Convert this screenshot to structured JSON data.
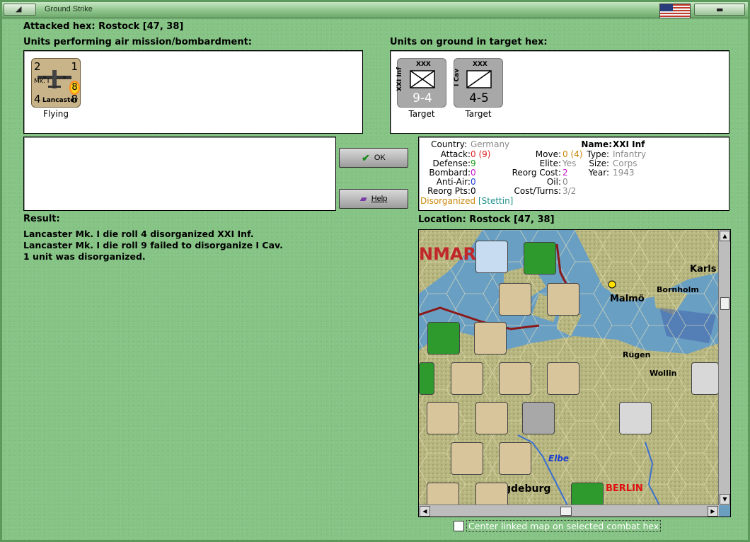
{
  "window": {
    "title": "Ground Strike"
  },
  "attacked_hex": {
    "label": "Attacked hex:",
    "value": "Rostock  [47, 38]"
  },
  "air_units": {
    "heading": "Units performing air mission/bombardment:",
    "items": [
      {
        "name": "Lancaster",
        "variant": "Mk. I",
        "top_left": "2",
        "top_right": "1",
        "bottom_left": "4",
        "bottom_right": "8",
        "badge": "8",
        "status": "Flying"
      }
    ]
  },
  "ground_units": {
    "heading": "Units on ground in target hex:",
    "items": [
      {
        "name": "XXI Inf",
        "size": "XXX",
        "strength": "9-4",
        "status": "Target"
      },
      {
        "name": "I Cav",
        "size": "XXX",
        "strength": "4-5",
        "status": "Target"
      }
    ]
  },
  "buttons": {
    "ok": "OK",
    "help": "Help"
  },
  "unit_info": {
    "country_label": "Country:",
    "country": "Germany",
    "attack_label": "Attack:",
    "attack": "0",
    "attack_mod": "(9)",
    "defense_label": "Defense:",
    "defense": "9",
    "bombard_label": "Bombard:",
    "bombard": "0",
    "antiair_label": "Anti-Air:",
    "antiair": "0",
    "reorg_label": "Reorg Pts:",
    "reorg": "0",
    "move_label": "Move:",
    "move": "0",
    "move_mod": "(4)",
    "elite_label": "Elite:",
    "elite": "Yes",
    "reorg_cost_label": "Reorg Cost:",
    "reorg_cost": "2",
    "oil_label": "Oil:",
    "oil": "0",
    "cost_turns_label": "Cost/Turns:",
    "cost_turns": "3/2",
    "name_label": "Name:",
    "name": "XXI Inf",
    "type_label": "Type:",
    "type": "Infantry",
    "size_label": "Size:",
    "size": "Corps",
    "year_label": "Year:",
    "year": "1943",
    "status": "Disorganized",
    "location": "[Stettin]"
  },
  "result": {
    "heading": "Result:",
    "lines": [
      "Lancaster Mk. I die roll 4 disorganized XXI Inf.",
      "Lancaster Mk. I die roll 9 failed to disorganize I Cav.",
      "1 unit was disorganized."
    ]
  },
  "location": {
    "label": "Location:",
    "value": "Rostock  [47, 38]"
  },
  "map": {
    "labels": [
      "NMAR",
      "Karls",
      "Malmö",
      "Bornholm",
      "Rügen",
      "Wollin",
      "Elbe",
      "BERLIN",
      "gdeburg"
    ]
  },
  "center_checkbox": {
    "label": "Center linked map on selected combat hex",
    "checked": false
  },
  "colors": {
    "window_bg": "#86c485",
    "panel_bg": "#ffffff",
    "target_counter": "#a8a8a8",
    "air_counter": "#c9b48a"
  }
}
